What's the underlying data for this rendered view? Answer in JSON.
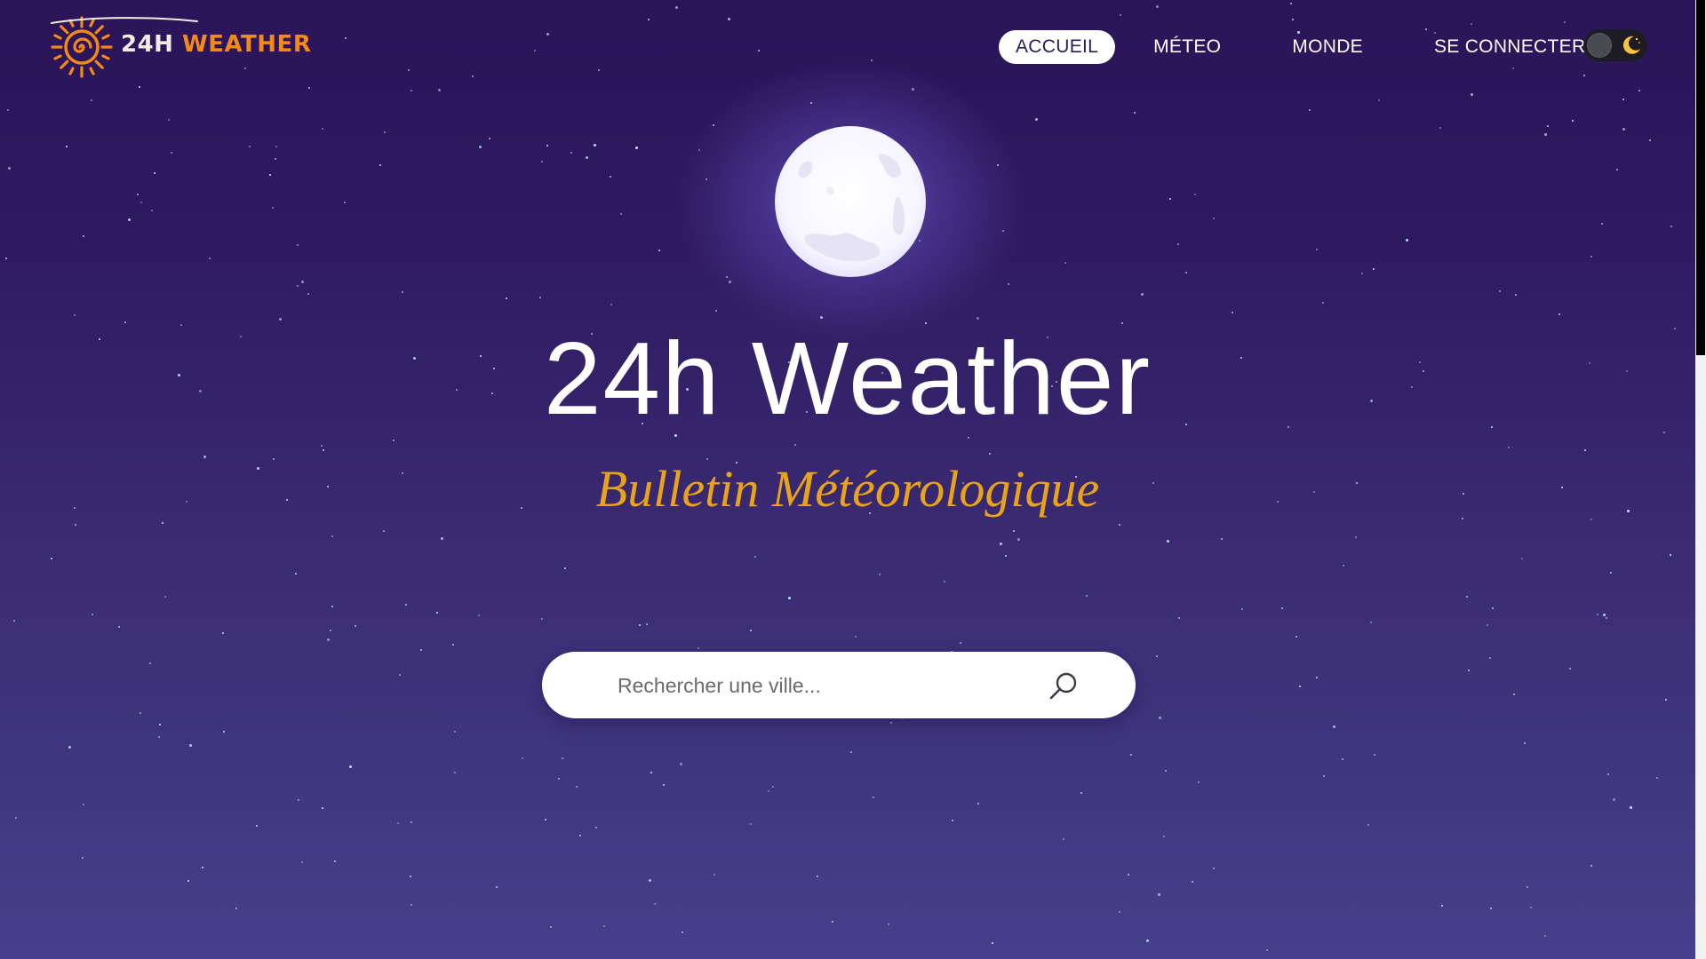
{
  "logo": {
    "brand_part1": "24H",
    "brand_part2": "WEATHER",
    "icon": "sun-swirl-icon",
    "colors": {
      "sun": "#f28a1b",
      "text": "#f1ece4"
    }
  },
  "nav": {
    "items": [
      {
        "label": "ACCUEIL",
        "active": true
      },
      {
        "label": "MÉTEO",
        "active": false
      },
      {
        "label": "MONDE",
        "active": false
      },
      {
        "label": "SE CONNECTER",
        "active": false
      }
    ]
  },
  "theme_toggle": {
    "icon": "crescent-moon-icon",
    "mode": "dark",
    "moon_color": "#f6c343"
  },
  "hero": {
    "title": "24h Weather",
    "subtitle": "Bulletin Météorologique",
    "subtitle_color": "#e8a31b",
    "moon_icon": "full-moon-icon"
  },
  "search": {
    "placeholder": "Rechercher une ville...",
    "value": "",
    "icon": "search-icon"
  },
  "colors": {
    "background_top": "#2b1458",
    "background_bottom": "#45408a",
    "star": "#c9e4ff"
  }
}
